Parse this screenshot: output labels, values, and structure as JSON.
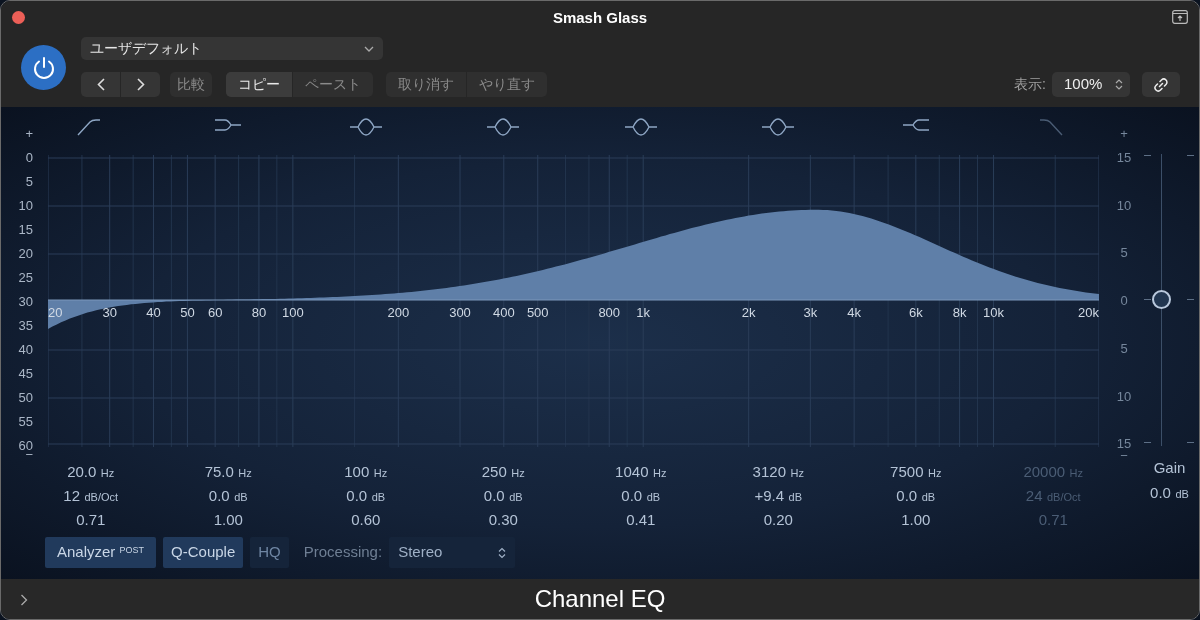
{
  "window": {
    "title": "Smash Glass"
  },
  "header": {
    "power_on": true,
    "preset": "ユーザデフォルト",
    "compare": "比較",
    "copy": "コピー",
    "paste": "ペースト",
    "undo": "取り消す",
    "redo": "やり直す",
    "view_label": "表示:",
    "view_value": "100%"
  },
  "graph": {
    "left_scale": [
      "+",
      "0",
      "5",
      "10",
      "15",
      "20",
      "25",
      "30",
      "35",
      "40",
      "45",
      "50",
      "55",
      "60",
      "−"
    ],
    "right_scale": [
      "+",
      "15",
      "10",
      "5",
      "0",
      "5",
      "10",
      "15",
      "−"
    ],
    "freq_labels": [
      "20",
      "30",
      "40",
      "50",
      "60",
      "80",
      "100",
      "200",
      "300",
      "400",
      "500",
      "800",
      "1k",
      "2k",
      "3k",
      "4k",
      "6k",
      "8k",
      "10k",
      "20k"
    ]
  },
  "bands": [
    {
      "kind": "lowcut",
      "enabled": true,
      "freq": "20.0",
      "freq_unit": "Hz",
      "gain": "12",
      "gain_unit": "dB/Oct",
      "q": "0.71"
    },
    {
      "kind": "lowshelf",
      "enabled": true,
      "freq": "75.0",
      "freq_unit": "Hz",
      "gain": "0.0",
      "gain_unit": "dB",
      "q": "1.00"
    },
    {
      "kind": "bell",
      "enabled": true,
      "freq": "100",
      "freq_unit": "Hz",
      "gain": "0.0",
      "gain_unit": "dB",
      "q": "0.60"
    },
    {
      "kind": "bell",
      "enabled": true,
      "freq": "250",
      "freq_unit": "Hz",
      "gain": "0.0",
      "gain_unit": "dB",
      "q": "0.30"
    },
    {
      "kind": "bell",
      "enabled": true,
      "freq": "1040",
      "freq_unit": "Hz",
      "gain": "0.0",
      "gain_unit": "dB",
      "q": "0.41"
    },
    {
      "kind": "bell",
      "enabled": true,
      "freq": "3120",
      "freq_unit": "Hz",
      "gain": "+9.4",
      "gain_unit": "dB",
      "q": "0.20"
    },
    {
      "kind": "highshelf",
      "enabled": true,
      "freq": "7500",
      "freq_unit": "Hz",
      "gain": "0.0",
      "gain_unit": "dB",
      "q": "1.00"
    },
    {
      "kind": "highcut",
      "enabled": false,
      "freq": "20000",
      "freq_unit": "Hz",
      "gain": "24",
      "gain_unit": "dB/Oct",
      "q": "0.71"
    }
  ],
  "gain": {
    "label": "Gain",
    "value": "0.0",
    "unit": "dB",
    "level": 0.5
  },
  "controls": {
    "analyzer": {
      "label": "Analyzer",
      "badge": "POST",
      "on": true
    },
    "q_couple": {
      "label": "Q-Couple",
      "on": true
    },
    "hq": {
      "label": "HQ",
      "on": false
    },
    "processing_label": "Processing:",
    "processing_value": "Stereo"
  },
  "bottom_bar": {
    "title": "Channel EQ"
  }
}
